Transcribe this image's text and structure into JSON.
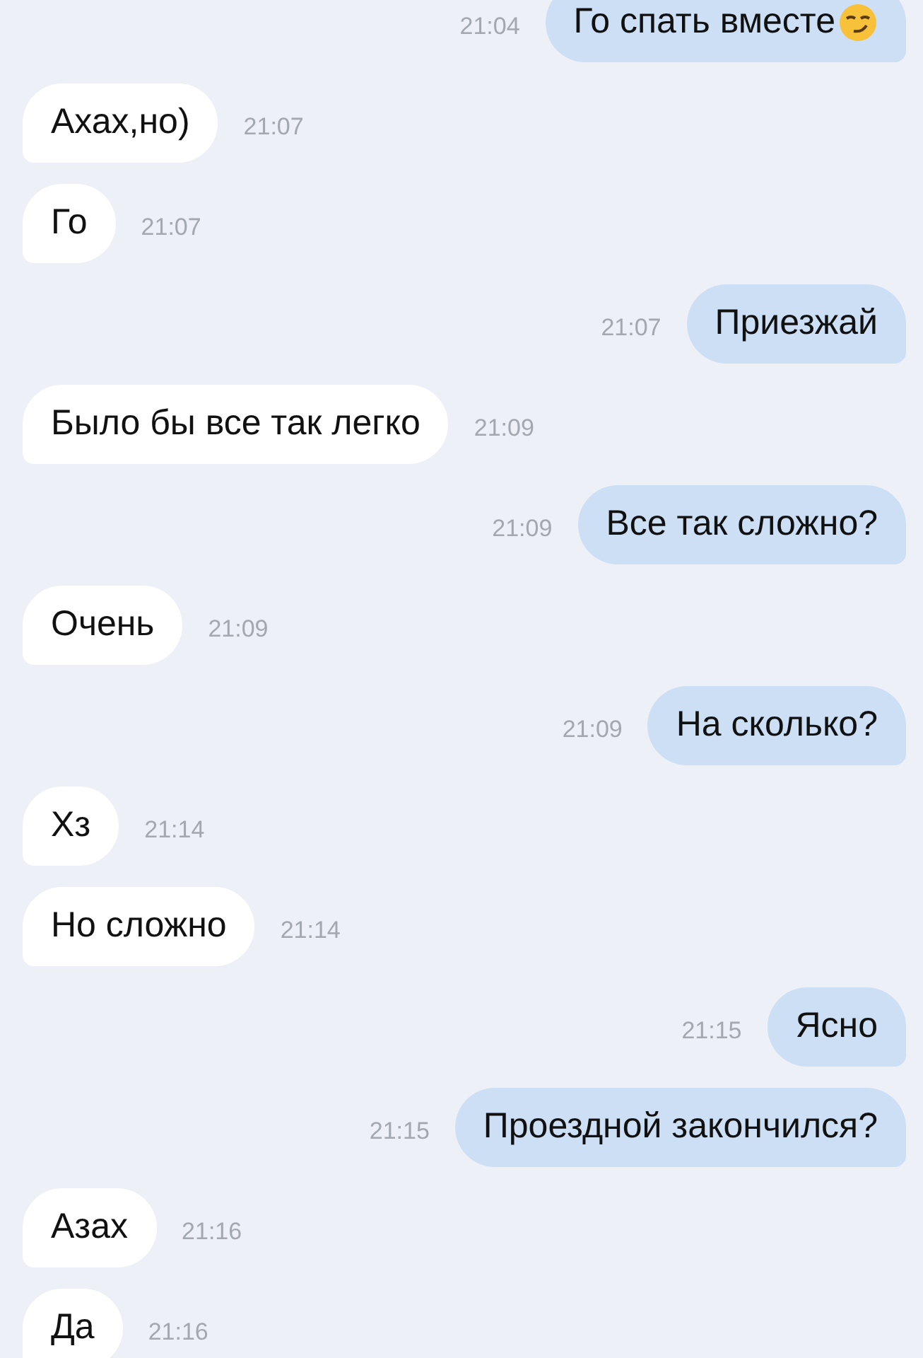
{
  "messages": [
    {
      "kind": "sent",
      "text": "Го спать вместе",
      "time": "21:04",
      "emoji": true
    },
    {
      "kind": "received",
      "text": "Ахах,но)",
      "time": "21:07"
    },
    {
      "kind": "received",
      "text": "Го",
      "time": "21:07"
    },
    {
      "kind": "sent",
      "text": "Приезжай",
      "time": "21:07"
    },
    {
      "kind": "received",
      "text": "Было бы все так легко",
      "time": "21:09"
    },
    {
      "kind": "sent",
      "text": "Все так сложно?",
      "time": "21:09"
    },
    {
      "kind": "received",
      "text": "Очень",
      "time": "21:09"
    },
    {
      "kind": "sent",
      "text": "На сколько?",
      "time": "21:09"
    },
    {
      "kind": "received",
      "text": "Хз",
      "time": "21:14"
    },
    {
      "kind": "received",
      "text": "Но сложно",
      "time": "21:14"
    },
    {
      "kind": "sent",
      "text": "Ясно",
      "time": "21:15"
    },
    {
      "kind": "sent",
      "text": "Проездной закончился?",
      "time": "21:15"
    },
    {
      "kind": "received",
      "text": "Азах",
      "time": "21:16"
    },
    {
      "kind": "received",
      "text": "Да",
      "time": "21:16"
    }
  ]
}
